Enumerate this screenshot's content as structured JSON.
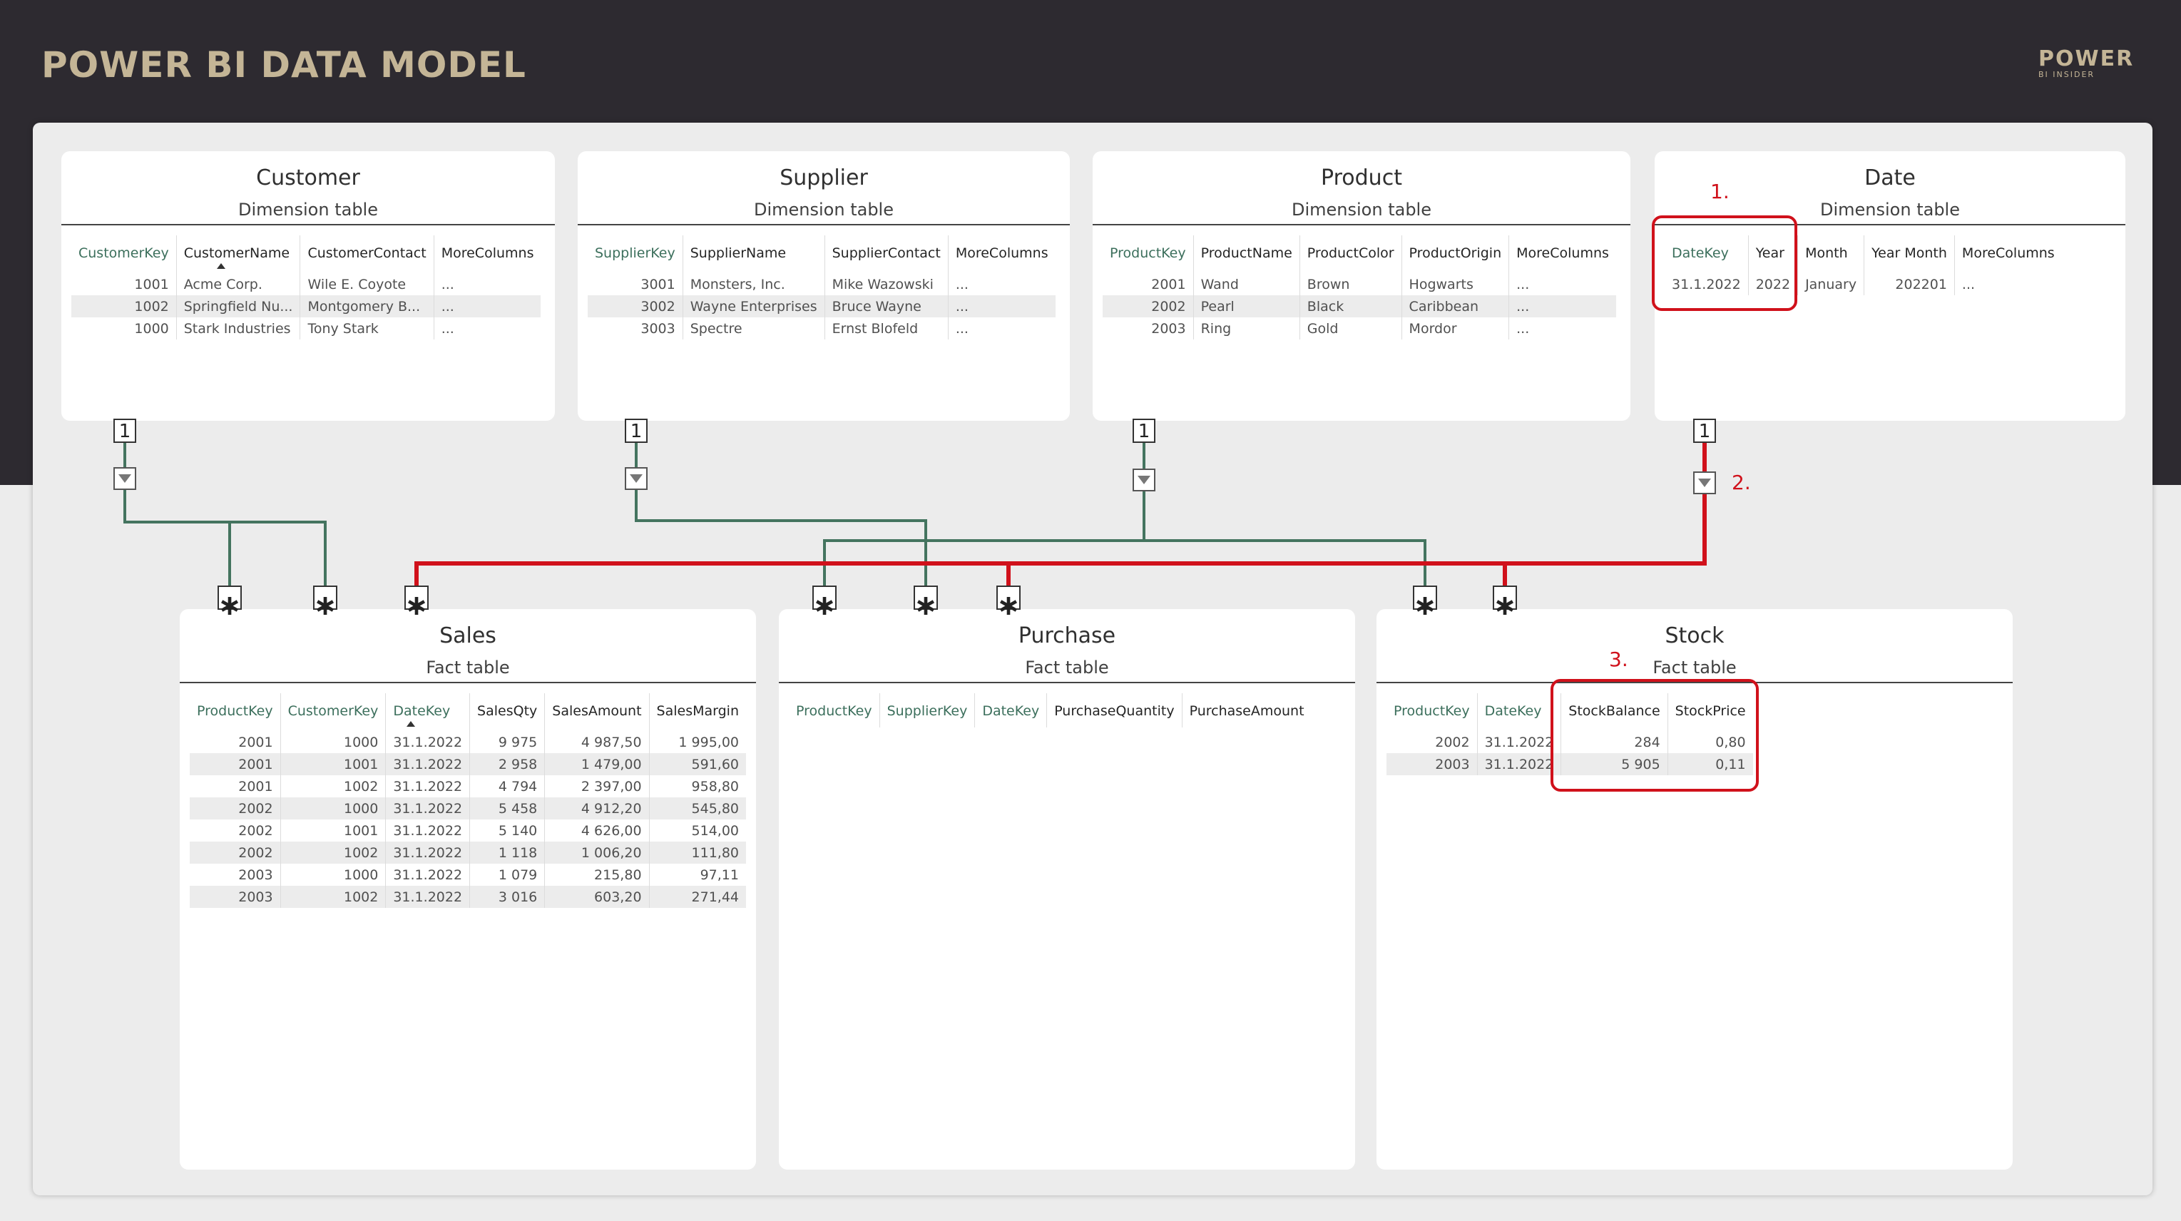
{
  "header": {
    "title": "POWER BI DATA MODEL",
    "logo_main": "POWER",
    "logo_sub": "BI INSIDER"
  },
  "cardinality": {
    "one": "1",
    "many": "∗"
  },
  "colors": {
    "relationship": "#44745f",
    "highlight": "#d0111b",
    "header_bg": "#2d2a30",
    "title": "#c4b596"
  },
  "tables": {
    "customer": {
      "title": "Customer",
      "subtitle": "Dimension table",
      "columns": [
        "CustomerKey",
        "CustomerName",
        "CustomerContact",
        "MoreColumns"
      ],
      "rows": [
        [
          "1001",
          "Acme Corp.",
          "Wile E. Coyote",
          "..."
        ],
        [
          "1002",
          "Springfield Nu...",
          "Montgomery B...",
          "..."
        ],
        [
          "1000",
          "Stark Industries",
          "Tony Stark",
          "..."
        ]
      ]
    },
    "supplier": {
      "title": "Supplier",
      "subtitle": "Dimension table",
      "columns": [
        "SupplierKey",
        "SupplierName",
        "SupplierContact",
        "MoreColumns"
      ],
      "rows": [
        [
          "3001",
          "Monsters, Inc.",
          "Mike Wazowski",
          "..."
        ],
        [
          "3002",
          "Wayne Enterprises",
          "Bruce Wayne",
          "..."
        ],
        [
          "3003",
          "Spectre",
          "Ernst Blofeld",
          "..."
        ]
      ]
    },
    "product": {
      "title": "Product",
      "subtitle": "Dimension table",
      "columns": [
        "ProductKey",
        "ProductName",
        "ProductColor",
        "ProductOrigin",
        "MoreColumns"
      ],
      "rows": [
        [
          "2001",
          "Wand",
          "Brown",
          "Hogwarts",
          "..."
        ],
        [
          "2002",
          "Pearl",
          "Black",
          "Caribbean",
          "..."
        ],
        [
          "2003",
          "Ring",
          "Gold",
          "Mordor",
          "..."
        ]
      ]
    },
    "date": {
      "title": "Date",
      "subtitle": "Dimension table",
      "columns": [
        "DateKey",
        "Year",
        "Month",
        "Year Month",
        "MoreColumns"
      ],
      "rows": [
        [
          "31.1.2022",
          "2022",
          "January",
          "202201",
          "..."
        ]
      ]
    },
    "sales": {
      "title": "Sales",
      "subtitle": "Fact table",
      "columns": [
        "ProductKey",
        "CustomerKey",
        "DateKey",
        "SalesQty",
        "SalesAmount",
        "SalesMargin"
      ],
      "rows": [
        [
          "2001",
          "1000",
          "31.1.2022",
          "9 975",
          "4 987,50",
          "1 995,00"
        ],
        [
          "2001",
          "1001",
          "31.1.2022",
          "2 958",
          "1 479,00",
          "591,60"
        ],
        [
          "2001",
          "1002",
          "31.1.2022",
          "4 794",
          "2 397,00",
          "958,80"
        ],
        [
          "2002",
          "1000",
          "31.1.2022",
          "5 458",
          "4 912,20",
          "545,80"
        ],
        [
          "2002",
          "1001",
          "31.1.2022",
          "5 140",
          "4 626,00",
          "514,00"
        ],
        [
          "2002",
          "1002",
          "31.1.2022",
          "1 118",
          "1 006,20",
          "111,80"
        ],
        [
          "2003",
          "1000",
          "31.1.2022",
          "1 079",
          "215,80",
          "97,11"
        ],
        [
          "2003",
          "1002",
          "31.1.2022",
          "3 016",
          "603,20",
          "271,44"
        ]
      ]
    },
    "purchase": {
      "title": "Purchase",
      "subtitle": "Fact table",
      "columns": [
        "ProductKey",
        "SupplierKey",
        "DateKey",
        "PurchaseQuantity",
        "PurchaseAmount"
      ],
      "rows": []
    },
    "stock": {
      "title": "Stock",
      "subtitle": "Fact table",
      "columns": [
        "ProductKey",
        "DateKey",
        "StockBalance",
        "StockPrice"
      ],
      "rows": [
        [
          "2002",
          "31.1.2022",
          "284",
          "0,80"
        ],
        [
          "2003",
          "31.1.2022",
          "5 905",
          "0,11"
        ]
      ]
    }
  },
  "annotations": [
    "1.",
    "2.",
    "3."
  ]
}
